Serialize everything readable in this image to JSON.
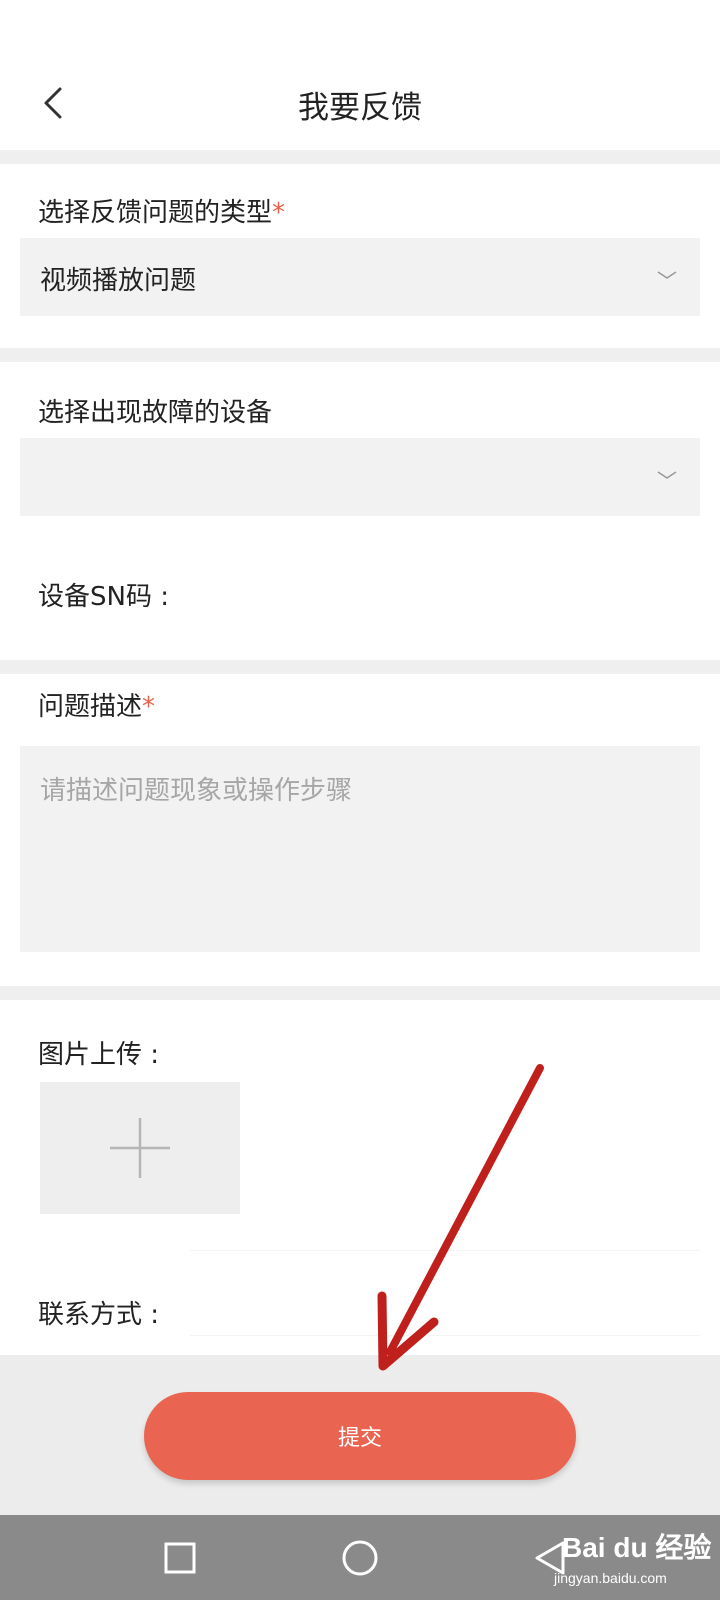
{
  "header": {
    "title": "我要反馈"
  },
  "type_section": {
    "label": "选择反馈问题的类型",
    "required_mark": "*",
    "selected": "视频播放问题"
  },
  "device_section": {
    "label": "选择出现故障的设备",
    "selected": "",
    "sn_label": "设备SN码 :"
  },
  "description": {
    "label": "问题描述",
    "required_mark": "*",
    "placeholder": "请描述问题现象或操作步骤"
  },
  "upload": {
    "label": "图片上传 :"
  },
  "contact": {
    "label": "联系方式 :",
    "value": ""
  },
  "submit": {
    "label": "提交"
  },
  "watermark": {
    "brand": "Bai du 经验",
    "url": "jingyan.baidu.com"
  },
  "colors": {
    "accent": "#ea6452",
    "required": "#e9604b",
    "field_bg": "#f2f2f2",
    "annotation": "#c0201c"
  },
  "icons": [
    "back-arrow-icon",
    "chevron-down-icon",
    "plus-icon",
    "nav-recent-icon",
    "nav-home-icon",
    "nav-back-icon"
  ]
}
